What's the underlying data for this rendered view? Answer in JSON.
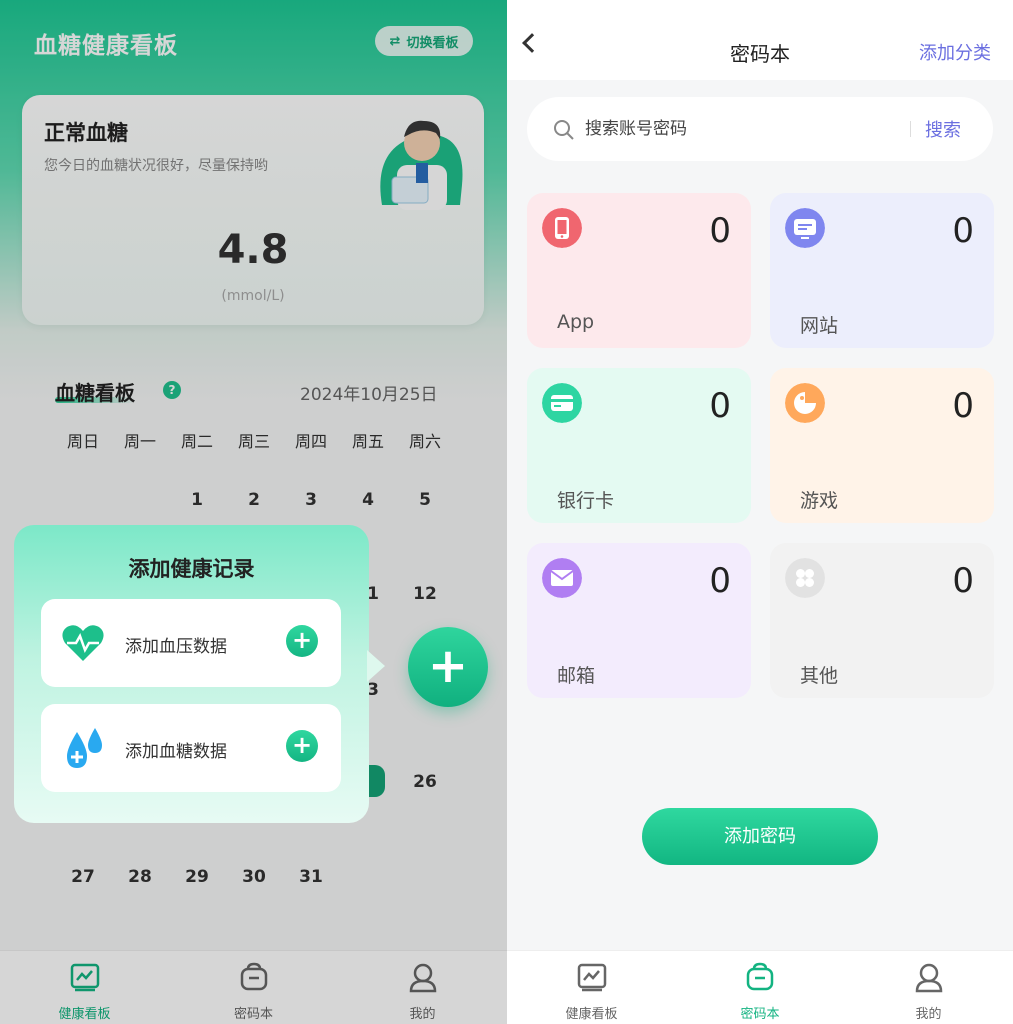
{
  "left": {
    "title": "血糖健康看板",
    "switch_label": "切换看板",
    "card": {
      "title": "正常血糖",
      "subtitle": "您今日的血糖状况很好，尽量保持哟",
      "value": "4.8",
      "unit": "(mmol/L)"
    },
    "section_title": "血糖看板",
    "help": "?",
    "date": "2024年10月25日",
    "weekdays": [
      "周日",
      "周一",
      "周二",
      "周三",
      "周四",
      "周五",
      "周六"
    ],
    "days": {
      "d1": "1",
      "d2": "2",
      "d3": "3",
      "d4": "4",
      "d5": "5",
      "d11": "1",
      "d12": "12",
      "d13": "3",
      "d26": "26",
      "d27": "27",
      "d28": "28",
      "d29": "29",
      "d30": "30",
      "d31": "31"
    },
    "popup": {
      "title": "添加健康记录",
      "items": [
        {
          "label": "添加血压数据"
        },
        {
          "label": "添加血糖数据"
        }
      ],
      "plus": "+"
    },
    "fab": "+",
    "accent": "#1dc995"
  },
  "tabs": [
    {
      "label": "健康看板",
      "icon": "chart-icon"
    },
    {
      "label": "密码本",
      "icon": "lock-box-icon"
    },
    {
      "label": "我的",
      "icon": "profile-icon"
    }
  ],
  "right": {
    "title": "密码本",
    "add_category": "添加分类",
    "search": {
      "placeholder": "搜索账号密码",
      "button": "搜索"
    },
    "categories": [
      {
        "name": "App",
        "count": "0",
        "icon": "phone-icon",
        "bg": "#fde9ec",
        "icon_color": "#f0666f"
      },
      {
        "name": "网站",
        "count": "0",
        "icon": "browser-icon",
        "bg": "#eceefc",
        "icon_color": "#7f86ef"
      },
      {
        "name": "银行卡",
        "count": "0",
        "icon": "card-icon",
        "bg": "#e4faf2",
        "icon_color": "#2ed5a2"
      },
      {
        "name": "游戏",
        "count": "0",
        "icon": "game-icon",
        "bg": "#fff3e8",
        "icon_color": "#ffa85b"
      },
      {
        "name": "邮箱",
        "count": "0",
        "icon": "mail-icon",
        "bg": "#f3ecfd",
        "icon_color": "#b07ef2"
      },
      {
        "name": "其他",
        "count": "0",
        "icon": "grid-icon",
        "bg": "#f2f2f2",
        "icon_color": "#dcdcdc"
      }
    ],
    "add_password": "添加密码"
  }
}
